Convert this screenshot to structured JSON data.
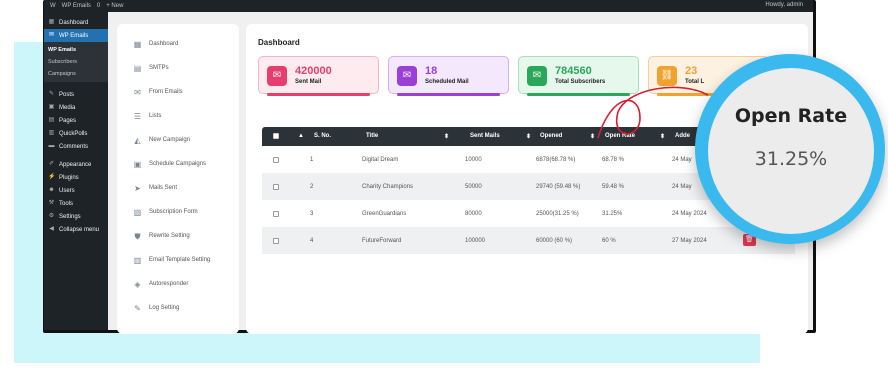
{
  "adminbar": {
    "site": "WP Emails",
    "comments": "0",
    "new": "+ New",
    "howdy": "Howdy, admin"
  },
  "wp_menu": {
    "items_top": [
      {
        "label": "Dashboard",
        "icon": "dashboard-icon"
      },
      {
        "label": "WP Emails",
        "icon": "email-icon"
      }
    ],
    "sub": [
      {
        "label": "WP Emails"
      },
      {
        "label": "Subscribers"
      },
      {
        "label": "Campaigns"
      }
    ],
    "items": [
      {
        "label": "Posts",
        "icon": "pin-icon"
      },
      {
        "label": "Media",
        "icon": "media-icon"
      },
      {
        "label": "Pages",
        "icon": "page-icon"
      },
      {
        "label": "QuickPolls",
        "icon": "chart-icon"
      },
      {
        "label": "Comments",
        "icon": "comment-icon"
      },
      {
        "label": "Appearance",
        "icon": "brush-icon"
      },
      {
        "label": "Plugins",
        "icon": "plugin-icon"
      },
      {
        "label": "Users",
        "icon": "user-icon"
      },
      {
        "label": "Tools",
        "icon": "wrench-icon"
      },
      {
        "label": "Settings",
        "icon": "settings-icon"
      },
      {
        "label": "Collapse menu",
        "icon": "collapse-icon"
      }
    ]
  },
  "plugin_menu": [
    {
      "label": "Dashboard",
      "icon": "grid-icon"
    },
    {
      "label": "SMTPs",
      "icon": "server-icon"
    },
    {
      "label": "From Emails",
      "icon": "envelope-icon"
    },
    {
      "label": "Lists",
      "icon": "list-icon"
    },
    {
      "label": "New Campaign",
      "icon": "megaphone-icon"
    },
    {
      "label": "Schedule Campaigns",
      "icon": "calendar-icon"
    },
    {
      "label": "Mails Sent",
      "icon": "send-icon"
    },
    {
      "label": "Subscription Form",
      "icon": "form-icon"
    },
    {
      "label": "Rewrite Setting",
      "icon": "shield-icon"
    },
    {
      "label": "Email Template Setting",
      "icon": "template-icon"
    },
    {
      "label": "Autoresponder",
      "icon": "autoresponder-icon"
    },
    {
      "label": "Log Setting",
      "icon": "log-icon"
    }
  ],
  "dashboard": {
    "title": "Dashboard",
    "cards": [
      {
        "value": "420000",
        "label": "Sent Mail",
        "color": "#e63e6d",
        "bg": "#fdebef",
        "border": "#f5b6c7",
        "icon": "mail-icon"
      },
      {
        "value": "18",
        "label": "Scheduled Mail",
        "color": "#9b3fd6",
        "bg": "#f3e8fc",
        "border": "#d7b0f2",
        "icon": "calendar-mail-icon"
      },
      {
        "value": "784560",
        "label": "Total Subscribers",
        "color": "#2aa85a",
        "bg": "#e6f7ec",
        "border": "#a8e0bd",
        "icon": "subscriber-icon"
      },
      {
        "value": "23",
        "label": "Total L",
        "color": "#f2a12f",
        "bg": "#fdf1e1",
        "border": "#f6cf98",
        "icon": "link-icon"
      }
    ],
    "table": {
      "headers": [
        "S. No.",
        "Title",
        "Sent Mails",
        "Opened",
        "Open Rate",
        "Adde"
      ],
      "rows": [
        {
          "sno": "1",
          "title": "Digital Dream",
          "sent": "10000",
          "opened": "6878(68.78 %)",
          "rate": "68.78 %",
          "added": "24 May"
        },
        {
          "sno": "2",
          "title": "Charity Champions",
          "sent": "50000",
          "opened": "29740 (59.48 %)",
          "rate": "59.48 %",
          "added": "24 May"
        },
        {
          "sno": "3",
          "title": "GreenGuardians",
          "sent": "80000",
          "opened": "25000(31.25 %)",
          "rate": "31.25%",
          "added": "24 May 2024"
        },
        {
          "sno": "4",
          "title": "FutureForward",
          "sent": "100000",
          "opened": "60000 (60 %)",
          "rate": "60 %",
          "added": "27 May 2024"
        }
      ]
    }
  },
  "callout": {
    "title": "Open Rate",
    "value": "31.25%"
  }
}
